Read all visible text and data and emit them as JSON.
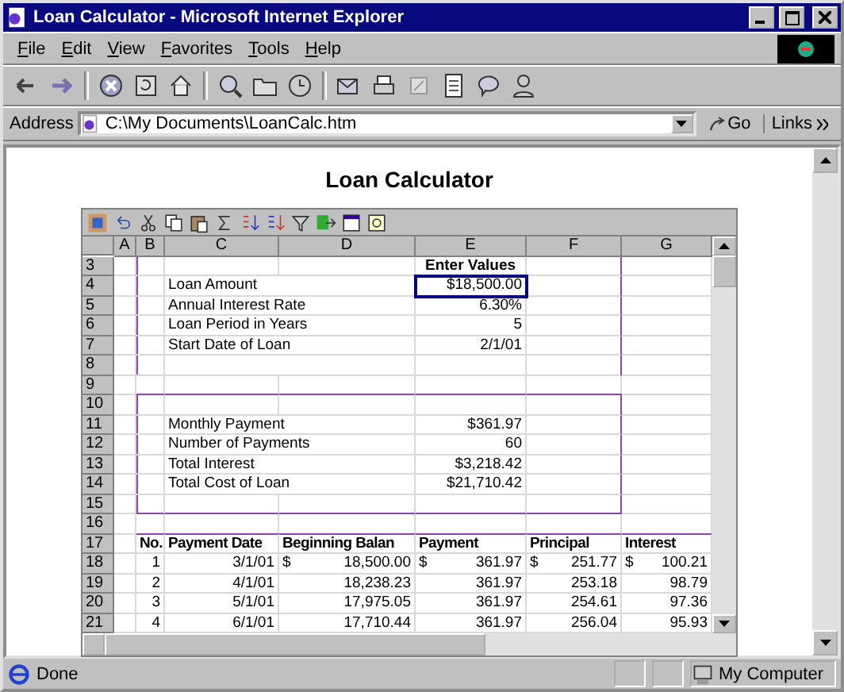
{
  "window": {
    "title": "Loan Calculator - Microsoft Internet Explorer"
  },
  "menu": [
    "File",
    "Edit",
    "View",
    "Favorites",
    "Tools",
    "Help"
  ],
  "address": {
    "label": "Address",
    "value": "C:\\My Documents\\LoanCalc.htm",
    "go": "Go",
    "links": "Links"
  },
  "page": {
    "heading": "Loan Calculator"
  },
  "sheet": {
    "columns": [
      "A",
      "B",
      "C",
      "D",
      "E",
      "F",
      "G"
    ],
    "rows": [
      {
        "number": "3",
        "kind": "title",
        "cells": [
          {
            "selected": false
          },
          {
            "selected": false
          },
          {
            "selected": false
          },
          {
            "selected": false
          },
          {
            "text": "Enter Values",
            "selected": false
          }
        ]
      },
      {
        "number": "4",
        "kind": "input",
        "cells": [
          {
            "selected": false
          },
          {
            "selected": false
          },
          {
            "text": "Loan Amount",
            "selected": false
          },
          {
            "text": "$18,500.00",
            "selected": true
          }
        ]
      },
      {
        "number": "5",
        "kind": "input",
        "cells": [
          {
            "selected": false
          },
          {
            "selected": false
          },
          {
            "text": "Annual Interest Rate",
            "selected": false
          },
          {
            "text": "6.30%",
            "selected": false
          }
        ]
      },
      {
        "number": "6",
        "kind": "input",
        "cells": [
          {
            "selected": false
          },
          {
            "selected": false
          },
          {
            "text": "Loan Period in Years",
            "selected": false
          },
          {
            "text": "5",
            "selected": false
          }
        ]
      },
      {
        "number": "7",
        "kind": "input",
        "cells": [
          {
            "selected": false
          },
          {
            "selected": false
          },
          {
            "text": "Start Date of Loan",
            "selected": false
          },
          {
            "text": "2/1/01",
            "selected": false
          }
        ]
      },
      {
        "number": "8",
        "kind": "input",
        "cells": []
      },
      {
        "number": "9",
        "kind": "blank",
        "cells": []
      },
      {
        "number": "10",
        "kind": "summary-top",
        "cells": []
      },
      {
        "number": "11",
        "kind": "summary",
        "cells": [
          {
            "selected": false
          },
          {
            "selected": false
          },
          {
            "text": "Monthly Payment",
            "selected": false
          },
          {
            "text": "$361.97",
            "selected": false
          }
        ]
      },
      {
        "number": "12",
        "kind": "summary",
        "cells": [
          {
            "selected": false
          },
          {
            "selected": false
          },
          {
            "text": "Number of Payments",
            "selected": false
          },
          {
            "text": "60",
            "selected": false
          }
        ]
      },
      {
        "number": "13",
        "kind": "summary",
        "cells": [
          {
            "selected": false
          },
          {
            "selected": false
          },
          {
            "text": "Total Interest",
            "selected": false
          },
          {
            "text": "$3,218.42",
            "selected": false
          }
        ]
      },
      {
        "number": "14",
        "kind": "summary",
        "cells": [
          {
            "selected": false
          },
          {
            "selected": false
          },
          {
            "text": "Total Cost of Loan",
            "selected": false
          },
          {
            "text": "$21,710.42",
            "selected": false
          }
        ]
      },
      {
        "number": "15",
        "kind": "summary-bottom",
        "cells": []
      },
      {
        "number": "16",
        "kind": "blank",
        "cells": []
      },
      {
        "number": "17",
        "kind": "header",
        "cells": [
          {
            "selected": false
          },
          {
            "text": "No.",
            "selected": false
          },
          {
            "text": "Payment Date",
            "selected": false
          },
          {
            "text": "Beginning Balan",
            "selected": false
          },
          {
            "text": "Payment",
            "selected": false
          },
          {
            "text": "Principal",
            "selected": false
          },
          {
            "text": "Interest",
            "selected": false
          }
        ]
      },
      {
        "number": "18",
        "kind": "data",
        "cells": [
          {
            "selected": false
          },
          {
            "text": "1",
            "selected": false
          },
          {
            "text": "3/1/01",
            "selected": false
          },
          {
            "currency": "$",
            "text": "18,500.00",
            "selected": false
          },
          {
            "currency": "$",
            "text": "361.97",
            "selected": false
          },
          {
            "currency": "$",
            "text": "251.77",
            "selected": false
          },
          {
            "currency": "$",
            "text": "100.21",
            "selected": false
          }
        ]
      },
      {
        "number": "19",
        "kind": "data",
        "cells": [
          {
            "selected": false
          },
          {
            "text": "2",
            "selected": false
          },
          {
            "text": "4/1/01",
            "selected": false
          },
          {
            "text": "18,238.23",
            "selected": false
          },
          {
            "text": "361.97",
            "selected": false
          },
          {
            "text": "253.18",
            "selected": false
          },
          {
            "text": "98.79",
            "selected": false
          }
        ]
      },
      {
        "number": "20",
        "kind": "data",
        "cells": [
          {
            "selected": false
          },
          {
            "text": "3",
            "selected": false
          },
          {
            "text": "5/1/01",
            "selected": false
          },
          {
            "text": "17,975.05",
            "selected": false
          },
          {
            "text": "361.97",
            "selected": false
          },
          {
            "text": "254.61",
            "selected": false
          },
          {
            "text": "97.36",
            "selected": false
          }
        ]
      },
      {
        "number": "21",
        "kind": "data",
        "cells": [
          {
            "selected": false
          },
          {
            "text": "4",
            "selected": false
          },
          {
            "text": "6/1/01",
            "selected": false
          },
          {
            "text": "17,710.44",
            "selected": false
          },
          {
            "text": "361.97",
            "selected": false
          },
          {
            "text": "256.04",
            "selected": false
          },
          {
            "text": "95.93",
            "selected": false
          }
        ]
      }
    ]
  },
  "status_bar": {
    "text": "Done",
    "zone": "My Computer"
  }
}
